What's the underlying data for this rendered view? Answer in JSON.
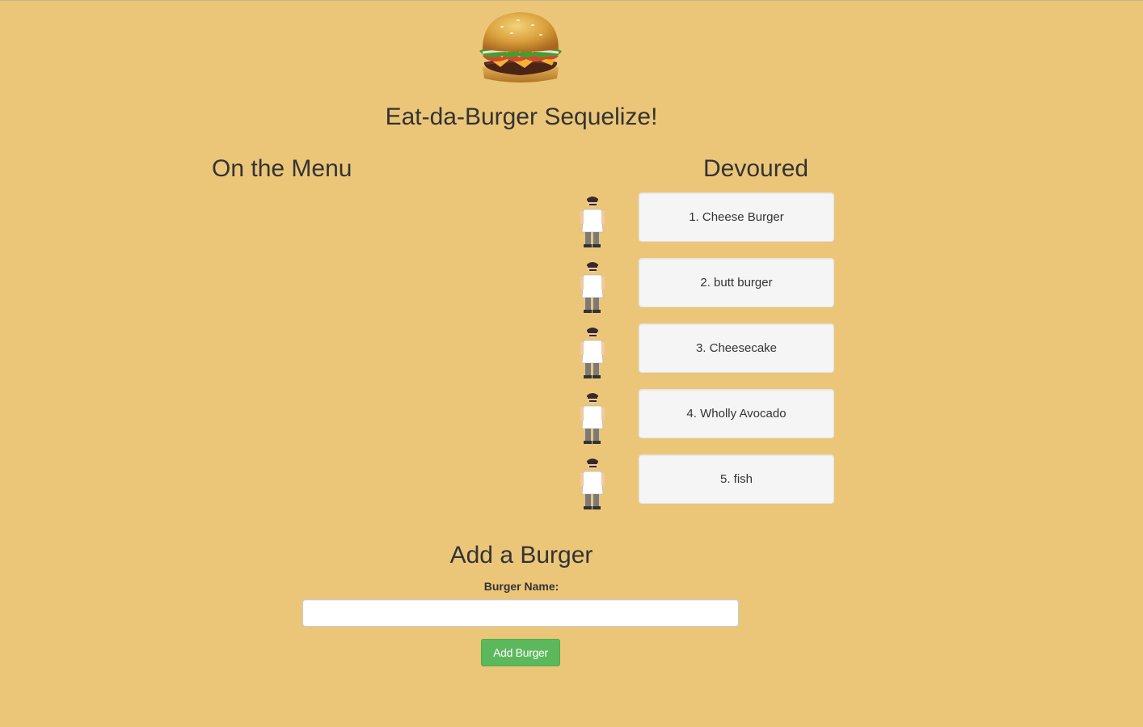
{
  "header": {
    "logo_icon": "burger-icon",
    "title": "Eat-da-Burger Sequelize!"
  },
  "menu": {
    "heading": "On the Menu",
    "items": []
  },
  "devoured": {
    "heading": "Devoured",
    "avatar_icon": "bob-chef-icon",
    "items": [
      {
        "label": "1. Cheese Burger"
      },
      {
        "label": "2. butt burger"
      },
      {
        "label": "3. Cheesecake"
      },
      {
        "label": "4. Wholly Avocado"
      },
      {
        "label": "5. fish"
      }
    ]
  },
  "add_form": {
    "heading": "Add a Burger",
    "field_label": "Burger Name:",
    "input_value": "",
    "input_placeholder": "",
    "button_label": "Add Burger"
  },
  "colors": {
    "background": "#ebc679",
    "button": "#5cb85c",
    "card": "#f5f5f5"
  }
}
